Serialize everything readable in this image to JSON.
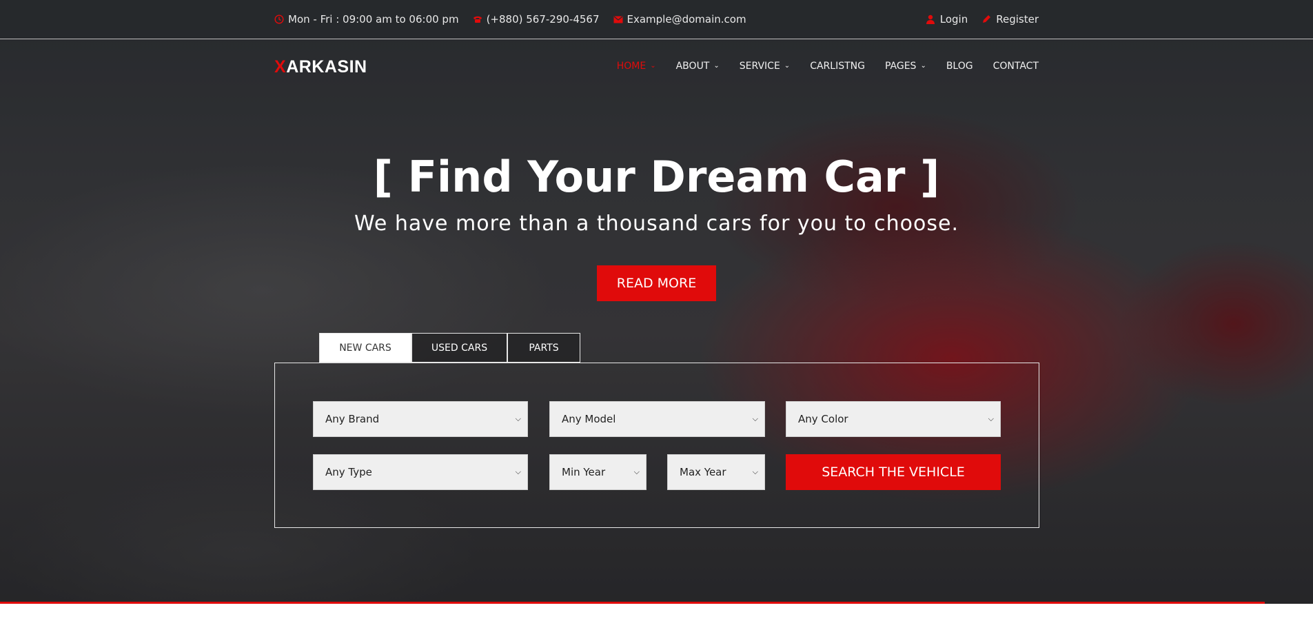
{
  "topbar": {
    "hours": "Mon - Fri : 09:00 am to 06:00 pm",
    "phone": "(+880) 567-290-4567",
    "email": "Example@domain.com",
    "login": "Login",
    "register": "Register"
  },
  "logo": {
    "accent": "X",
    "rest": "ARKASIN"
  },
  "nav": {
    "home": "HOME",
    "about": "ABOUT",
    "service": "SERVICE",
    "carlisting": "CARLISTNG",
    "pages": "PAGES",
    "blog": "BLOG",
    "contact": "CONTACT"
  },
  "hero": {
    "title": "[ Find Your Dream Car ]",
    "subtitle": "We have more than a thousand cars for you to choose.",
    "cta": "READ MORE"
  },
  "search": {
    "tabs": [
      "NEW CARS",
      "USED CARS",
      "PARTS"
    ],
    "brand": "Any Brand",
    "model": "Any Model",
    "color": "Any Color",
    "type": "Any Type",
    "min_year": "Min Year",
    "max_year": "Max Year",
    "submit": "SEARCH THE VEHICLE"
  },
  "colors": {
    "accent": "#e00b0b",
    "topbar_bg": "#26292c"
  }
}
